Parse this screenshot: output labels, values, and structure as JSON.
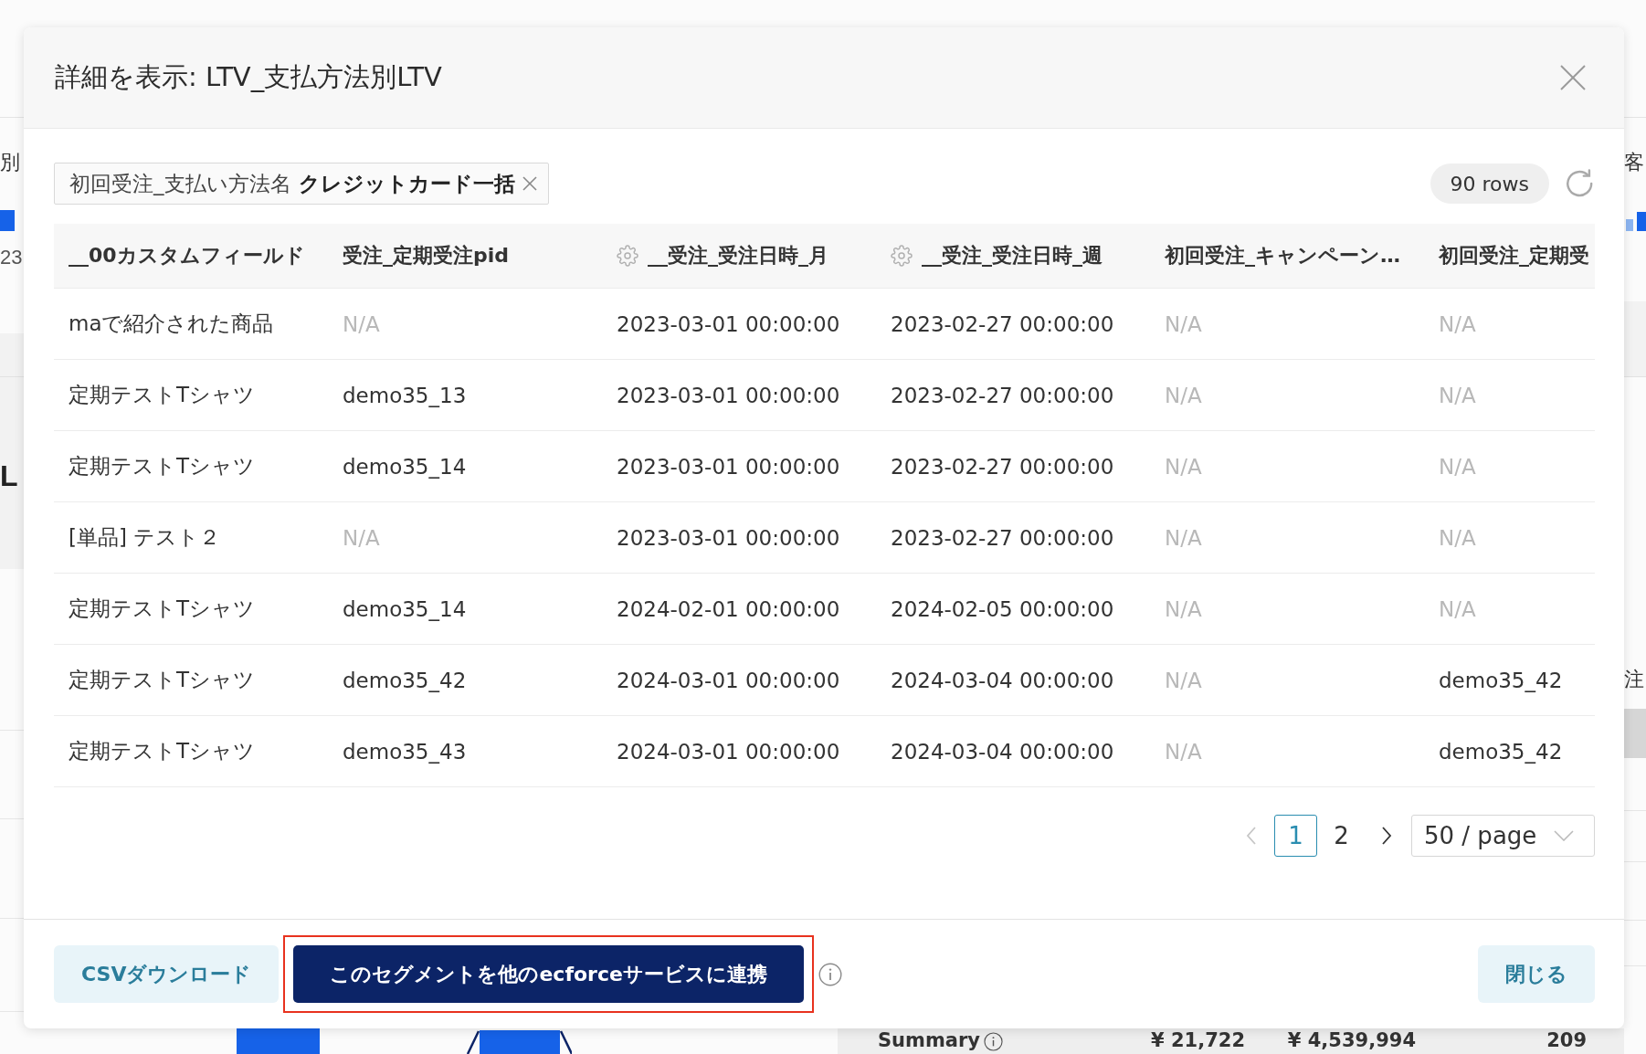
{
  "background_page": {
    "left_edge": [
      {
        "text": "別",
        "kind": "label"
      },
      {
        "text": "23",
        "kind": "value"
      },
      {
        "text": "L",
        "kind": "heading"
      }
    ],
    "right_edge": [
      "客",
      "注"
    ],
    "summary": {
      "label": "Summary",
      "values": [
        "¥ 21,722",
        "¥ 4,539,994",
        "209"
      ]
    }
  },
  "dialog": {
    "title": "詳細を表示: LTV_支払方法別LTV",
    "filter": {
      "field": "初回受注_支払い方法名",
      "value": "クレジットカード一括"
    },
    "row_count": "90 rows",
    "table": {
      "columns": [
        {
          "label": "__00カスタムフィールド",
          "settings": false
        },
        {
          "label": "受注_定期受注pid",
          "settings": false
        },
        {
          "label": "__受注_受注日時_月",
          "settings": true
        },
        {
          "label": "__受注_受注日時_週",
          "settings": true
        },
        {
          "label": "初回受注_キャンペーン…",
          "settings": false
        },
        {
          "label": "初回受注_定期受",
          "settings": false
        }
      ],
      "rows": [
        {
          "cells": [
            {
              "text": "maで紹介された商品",
              "muted": false
            },
            {
              "text": "N/A",
              "muted": true
            },
            {
              "text": "2023-03-01 00:00:00",
              "muted": false
            },
            {
              "text": "2023-02-27 00:00:00",
              "muted": false
            },
            {
              "text": "N/A",
              "muted": true
            },
            {
              "text": "N/A",
              "muted": true
            }
          ]
        },
        {
          "cells": [
            {
              "text": "定期テストTシャツ",
              "muted": false
            },
            {
              "text": "demo35_13",
              "muted": false
            },
            {
              "text": "2023-03-01 00:00:00",
              "muted": false
            },
            {
              "text": "2023-02-27 00:00:00",
              "muted": false
            },
            {
              "text": "N/A",
              "muted": true
            },
            {
              "text": "N/A",
              "muted": true
            }
          ]
        },
        {
          "cells": [
            {
              "text": "定期テストTシャツ",
              "muted": false
            },
            {
              "text": "demo35_14",
              "muted": false
            },
            {
              "text": "2023-03-01 00:00:00",
              "muted": false
            },
            {
              "text": "2023-02-27 00:00:00",
              "muted": false
            },
            {
              "text": "N/A",
              "muted": true
            },
            {
              "text": "N/A",
              "muted": true
            }
          ]
        },
        {
          "cells": [
            {
              "text": "[単品] テスト２",
              "muted": false
            },
            {
              "text": "N/A",
              "muted": true
            },
            {
              "text": "2023-03-01 00:00:00",
              "muted": false
            },
            {
              "text": "2023-02-27 00:00:00",
              "muted": false
            },
            {
              "text": "N/A",
              "muted": true
            },
            {
              "text": "N/A",
              "muted": true
            }
          ]
        },
        {
          "cells": [
            {
              "text": "定期テストTシャツ",
              "muted": false
            },
            {
              "text": "demo35_14",
              "muted": false
            },
            {
              "text": "2024-02-01 00:00:00",
              "muted": false
            },
            {
              "text": "2024-02-05 00:00:00",
              "muted": false
            },
            {
              "text": "N/A",
              "muted": true
            },
            {
              "text": "N/A",
              "muted": true
            }
          ]
        },
        {
          "cells": [
            {
              "text": "定期テストTシャツ",
              "muted": false
            },
            {
              "text": "demo35_42",
              "muted": false
            },
            {
              "text": "2024-03-01 00:00:00",
              "muted": false
            },
            {
              "text": "2024-03-04 00:00:00",
              "muted": false
            },
            {
              "text": "N/A",
              "muted": true
            },
            {
              "text": "demo35_42",
              "muted": false
            }
          ]
        },
        {
          "cells": [
            {
              "text": "定期テストTシャツ",
              "muted": false
            },
            {
              "text": "demo35_43",
              "muted": false
            },
            {
              "text": "2024-03-01 00:00:00",
              "muted": false
            },
            {
              "text": "2024-03-04 00:00:00",
              "muted": false
            },
            {
              "text": "N/A",
              "muted": true
            },
            {
              "text": "demo35_42",
              "muted": false
            }
          ]
        }
      ]
    },
    "pagination": {
      "prev_disabled": true,
      "pages": [
        {
          "label": "1",
          "selected": true
        },
        {
          "label": "2",
          "selected": false
        }
      ],
      "next_disabled": false,
      "page_size": "50 / page"
    },
    "buttons": [
      {
        "label": "CSVダウンロード",
        "kind": "secondary",
        "highlighted": false,
        "info": false
      },
      {
        "label": "このセグメントを他のecforceサービスに連携",
        "kind": "primary",
        "highlighted": true,
        "info": true
      },
      {
        "label": "閉じる",
        "kind": "secondary",
        "highlighted": false,
        "info": false
      }
    ]
  }
}
